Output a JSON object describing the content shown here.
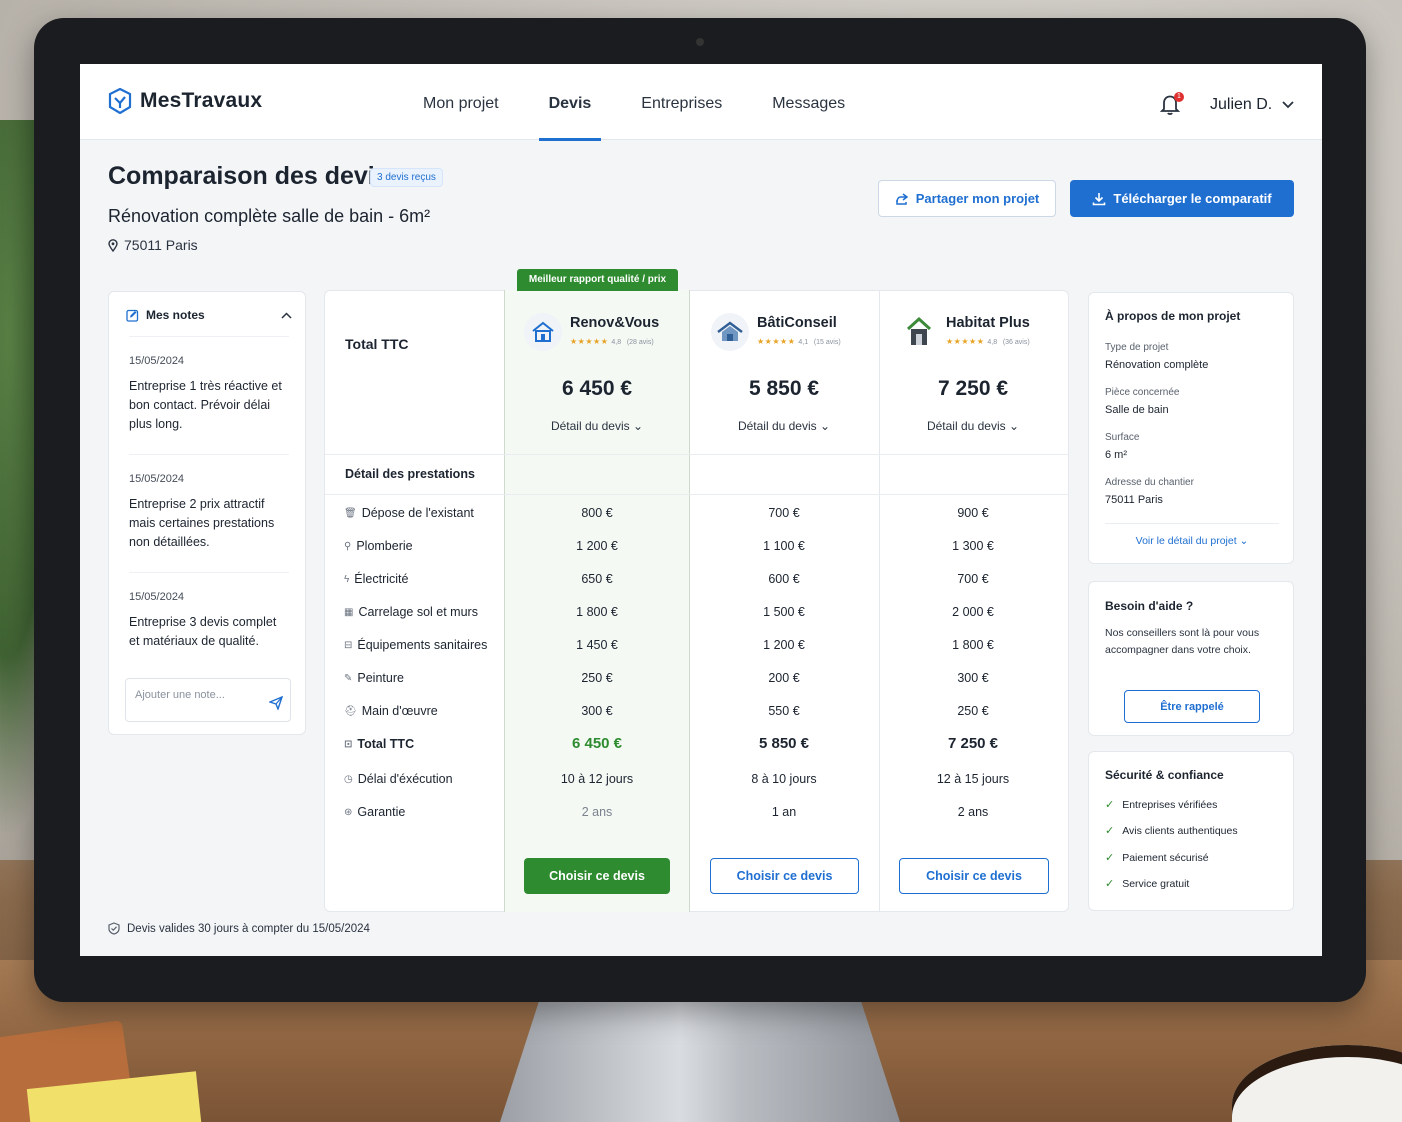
{
  "app": {
    "name": "MesTravaux"
  },
  "nav": [
    {
      "label": "Mon projet"
    },
    {
      "label": "Devis",
      "active": true
    },
    {
      "label": "Entreprises"
    },
    {
      "label": "Messages"
    }
  ],
  "notifications": {
    "count": "1"
  },
  "user": {
    "name": "Julien D."
  },
  "header": {
    "title": "Comparaison des devis",
    "badge": "3 devis reçus",
    "subtitle": "Rénovation complète salle de bain - 6m²",
    "location": "75011 Paris",
    "share_label": "Partager mon projet",
    "download_label": "Télécharger le comparatif"
  },
  "notes": {
    "title": "Mes notes",
    "items": [
      {
        "date": "15/05/2024",
        "text": "Entreprise 1 très réactive et bon contact. Prévoir délai plus long."
      },
      {
        "date": "15/05/2024",
        "text": "Entreprise 2 prix attractif mais certaines prestations non détaillées."
      },
      {
        "date": "15/05/2024",
        "text": "Entreprise 3 devis complet et matériaux de qualité."
      }
    ],
    "input_placeholder": "Ajouter une note..."
  },
  "comparison": {
    "best_tag": "Meilleur rapport qualité / prix",
    "total_label": "Total TTC",
    "detail_header": "Détail des prestations",
    "detail_link": "Détail du devis",
    "choose_label": "Choisir ce devis",
    "vendors": [
      {
        "name": "Renov&Vous",
        "rating": "4,8",
        "reviews": "(28 avis)",
        "price": "6 450 €"
      },
      {
        "name": "BâtiConseil",
        "rating": "4,1",
        "reviews": "(15 avis)",
        "price": "5 850 €"
      },
      {
        "name": "Habitat Plus",
        "rating": "4,8",
        "reviews": "(36 avis)",
        "price": "7 250 €"
      }
    ],
    "rows": [
      {
        "label": "Dépose de l'existant",
        "icon": "trash-icon",
        "values": [
          "800 €",
          "700 €",
          "900 €"
        ]
      },
      {
        "label": "Plomberie",
        "icon": "pipe-icon",
        "values": [
          "1 200 €",
          "1 100 €",
          "1 300 €"
        ]
      },
      {
        "label": "Électricité",
        "icon": "bolt-icon",
        "values": [
          "650 €",
          "600 €",
          "700 €"
        ]
      },
      {
        "label": "Carrelage sol et murs",
        "icon": "grid-icon",
        "values": [
          "1 800 €",
          "1 500 €",
          "2 000 €"
        ]
      },
      {
        "label": "Équipements sanitaires",
        "icon": "sink-icon",
        "values": [
          "1 450 €",
          "1 200 €",
          "1 800 €"
        ]
      },
      {
        "label": "Peinture",
        "icon": "brush-icon",
        "values": [
          "250 €",
          "200 €",
          "300 €"
        ]
      },
      {
        "label": "Main d'œuvre",
        "icon": "worker-icon",
        "values": [
          "300 €",
          "550 €",
          "250 €"
        ]
      },
      {
        "label": "Total TTC",
        "icon": "lock-icon",
        "values": [
          "6 450 €",
          "5 850 €",
          "7 250 €"
        ]
      },
      {
        "label": "Délai d'éxécution",
        "icon": "clock-icon",
        "values": [
          "10 à 12 jours",
          "8 à 10 jours",
          "12 à 15 jours"
        ]
      },
      {
        "label": "Garantie",
        "icon": "shield-icon",
        "values": [
          "2 ans",
          "1 an",
          "2 ans"
        ]
      }
    ]
  },
  "project": {
    "title": "À propos de mon projet",
    "fields": [
      {
        "label": "Type de projet",
        "value": "Rénovation complète"
      },
      {
        "label": "Pièce concernée",
        "value": "Salle de bain"
      },
      {
        "label": "Surface",
        "value": "6 m²"
      },
      {
        "label": "Adresse du chantier",
        "value": "75011 Paris"
      }
    ],
    "link": "Voir le détail du projet"
  },
  "help": {
    "title": "Besoin d'aide ?",
    "text": "Nos conseillers sont là pour vous accompagner dans votre choix.",
    "button": "Être rappelé"
  },
  "trust": {
    "title": "Sécurité & confiance",
    "items": [
      "Entreprises vérifiées",
      "Avis clients authentiques",
      "Paiement sécurisé",
      "Service gratuit"
    ]
  },
  "footer": {
    "text": "Devis valides 30 jours à compter du 15/05/2024"
  },
  "colors": {
    "primary": "#1f6fd1",
    "success": "#2e8b2f",
    "stars": "#e7a325"
  }
}
